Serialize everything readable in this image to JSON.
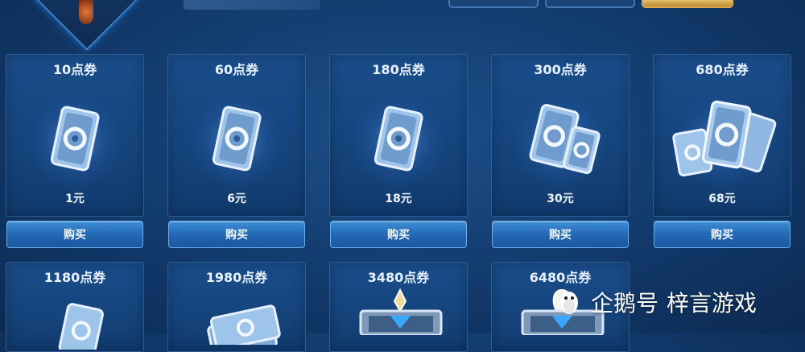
{
  "watermark": {
    "brand": "企鹅号",
    "account": "梓言游戏"
  },
  "colors": {
    "accent": "#2468b4",
    "card_bg": "#15447c",
    "button_border": "#6ab0ef"
  },
  "products": [
    {
      "title": "10点券",
      "price": "1元",
      "buy_label": "购买",
      "icon": "single-voucher-icon"
    },
    {
      "title": "60点券",
      "price": "6元",
      "buy_label": "购买",
      "icon": "single-voucher-icon"
    },
    {
      "title": "180点券",
      "price": "18元",
      "buy_label": "购买",
      "icon": "single-voucher-icon"
    },
    {
      "title": "300点券",
      "price": "30元",
      "buy_label": "购买",
      "icon": "double-voucher-icon"
    },
    {
      "title": "680点券",
      "price": "68元",
      "buy_label": "购买",
      "icon": "voucher-fan-icon"
    },
    {
      "title": "1180点券",
      "icon": "voucher-fan-icon"
    },
    {
      "title": "1980点券",
      "icon": "voucher-stack-icon"
    },
    {
      "title": "3480点券",
      "icon": "treasure-chest-icon"
    },
    {
      "title": "6480点券",
      "icon": "treasure-chest-icon"
    }
  ]
}
